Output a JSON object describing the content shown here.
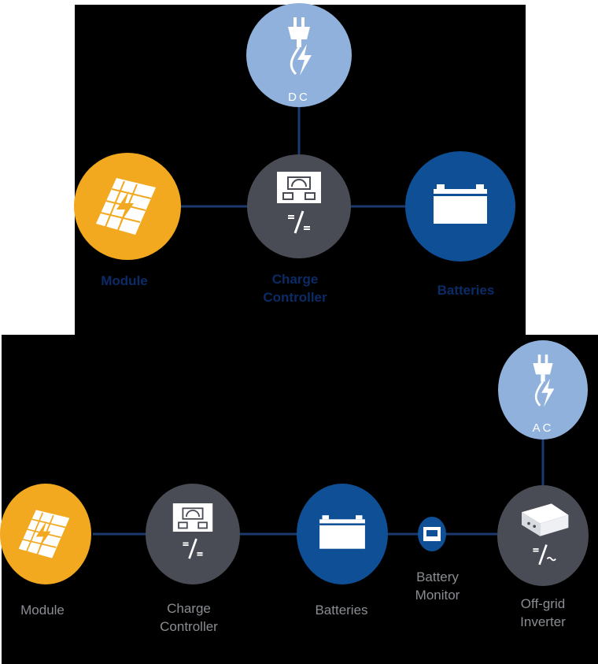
{
  "colors": {
    "background": "#000000",
    "module": "#f2a81f",
    "controller": "#4a4c55",
    "battery": "#0e4f96",
    "plug": "#8fb1db",
    "line": "#1d3a6e",
    "label_dark": "#0b2b66",
    "label_gray": "#8a8d92"
  },
  "dc_system": {
    "plug": {
      "icon": "dc-plug-icon",
      "text": "DC"
    },
    "module": {
      "icon": "solar-panel-icon",
      "label": "Module"
    },
    "controller": {
      "icon": "charge-controller-icon",
      "symbol": "=/=",
      "label_line1": "Charge",
      "label_line2": "Controller"
    },
    "batteries": {
      "icon": "battery-icon",
      "label": "Batteries"
    }
  },
  "ac_system": {
    "plug": {
      "icon": "ac-plug-icon",
      "text": "AC"
    },
    "module": {
      "icon": "solar-panel-icon",
      "label": "Module"
    },
    "controller": {
      "icon": "charge-controller-icon",
      "symbol": "=/=",
      "label_line1": "Charge",
      "label_line2": "Controller"
    },
    "batteries": {
      "icon": "battery-icon",
      "label": "Batteries"
    },
    "monitor": {
      "icon": "battery-monitor-icon",
      "label_line1": "Battery",
      "label_line2": "Monitor"
    },
    "inverter": {
      "icon": "inverter-icon",
      "symbol": "=/~",
      "label_line1": "Off-grid",
      "label_line2": "Inverter"
    }
  }
}
